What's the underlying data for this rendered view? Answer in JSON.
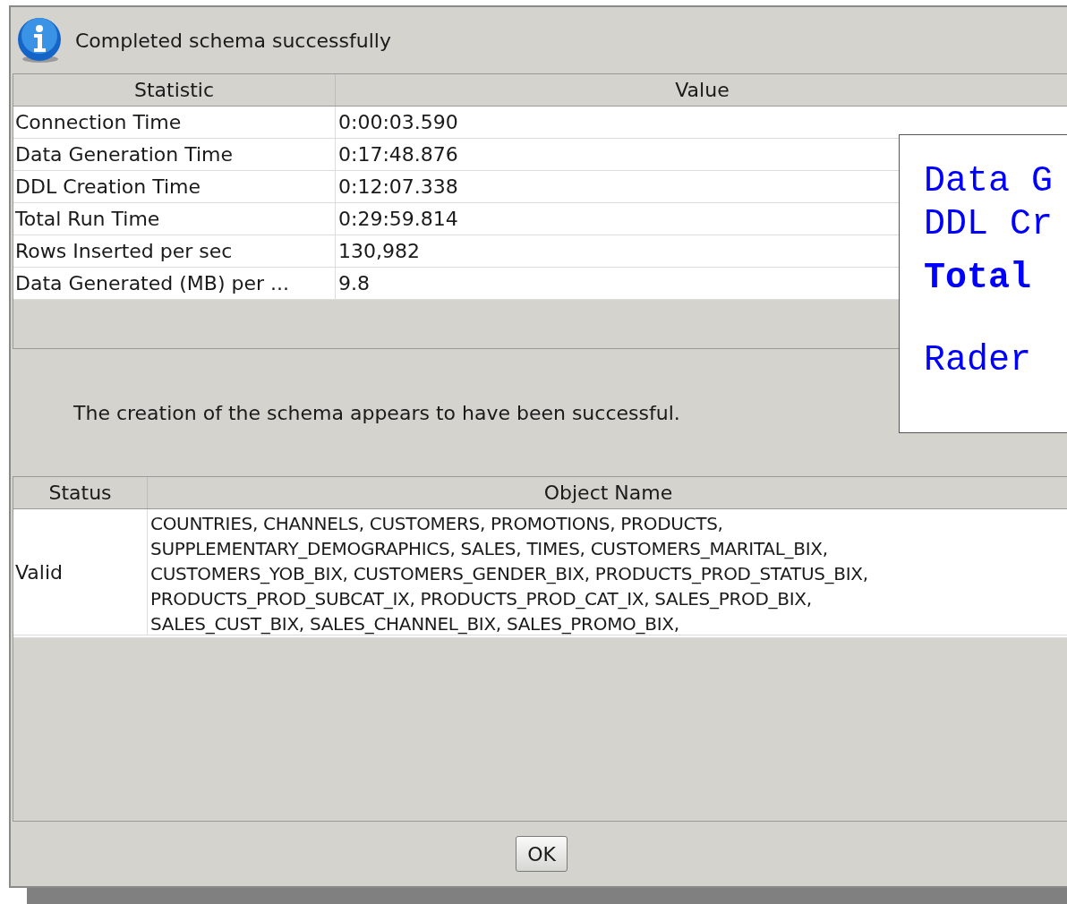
{
  "dialog": {
    "title": "Completed schema successfully"
  },
  "statistics_table": {
    "columns": [
      "Statistic",
      "Value"
    ],
    "rows": [
      {
        "statistic": "Connection Time",
        "value": "0:00:03.590"
      },
      {
        "statistic": "Data Generation Time",
        "value": "0:17:48.876"
      },
      {
        "statistic": "DDL Creation Time",
        "value": "0:12:07.338"
      },
      {
        "statistic": "Total Run Time",
        "value": "0:29:59.814"
      },
      {
        "statistic": "Rows Inserted per sec",
        "value": "130,982"
      },
      {
        "statistic": "Data Generated (MB) per ...",
        "value": "9.8"
      }
    ]
  },
  "message": "The creation of the schema appears to have been successful.",
  "objects_table": {
    "columns": [
      "Status",
      "Object Name"
    ],
    "rows": [
      {
        "status": "Valid",
        "object_name": "COUNTRIES, CHANNELS, CUSTOMERS, PROMOTIONS, PRODUCTS,\nSUPPLEMENTARY_DEMOGRAPHICS, SALES, TIMES, CUSTOMERS_MARITAL_BIX,\nCUSTOMERS_YOB_BIX, CUSTOMERS_GENDER_BIX, PRODUCTS_PROD_STATUS_BIX,\nPRODUCTS_PROD_SUBCAT_IX, PRODUCTS_PROD_CAT_IX, SALES_PROD_BIX,\nSALES_CUST_BIX, SALES_CHANNEL_BIX, SALES_PROMO_BIX,"
      }
    ]
  },
  "buttons": [
    "OK"
  ],
  "overlay": {
    "lines": [
      {
        "text": "Data G",
        "bold": false
      },
      {
        "text": "DDL Cr",
        "bold": false
      },
      {
        "text": "Total",
        "bold": true
      },
      {
        "text": "Rader",
        "bold": false
      }
    ]
  }
}
